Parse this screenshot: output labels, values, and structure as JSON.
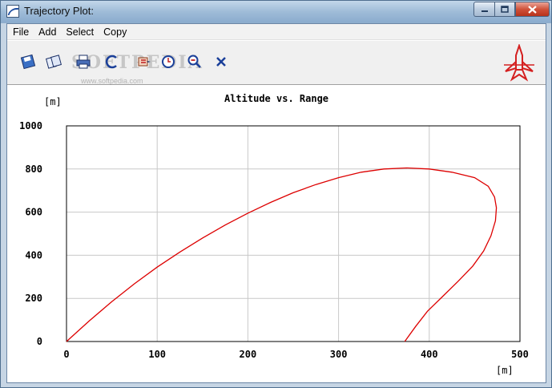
{
  "window": {
    "title": "Trajectory Plot:"
  },
  "menu": {
    "items": [
      "File",
      "Add",
      "Select",
      "Copy"
    ]
  },
  "toolbar": {
    "tools": [
      "diskette-icon",
      "copy-icon",
      "print-icon",
      "refresh-icon",
      "options-icon",
      "timer-icon",
      "zoom-out-icon",
      "close-x-icon"
    ],
    "watermark": "SOFTPEDIA",
    "watermark_url": "www.softpedia.com"
  },
  "colors": {
    "curve": "#dd0000",
    "grid": "#c8c8c8"
  },
  "chart_data": {
    "type": "line",
    "title": "Altitude vs. Range",
    "ylabel": "[m]",
    "xlabel": "[m]",
    "xlim": [
      0,
      500
    ],
    "ylim": [
      0,
      1000
    ],
    "xticks": [
      0,
      100,
      200,
      300,
      400,
      500
    ],
    "yticks": [
      0,
      200,
      400,
      600,
      800,
      1000
    ],
    "grid": true,
    "series": [
      {
        "x": [
          0,
          25,
          50,
          75,
          100,
          125,
          150,
          175,
          200,
          225,
          250,
          275,
          300,
          325,
          350,
          375,
          400,
          425,
          450,
          465,
          472,
          474,
          473,
          468,
          460,
          448,
          432,
          415,
          398,
          385,
          373
        ],
        "y": [
          0,
          95,
          185,
          268,
          345,
          415,
          480,
          540,
          595,
          645,
          690,
          728,
          760,
          785,
          800,
          805,
          800,
          785,
          760,
          720,
          670,
          620,
          560,
          490,
          420,
          350,
          280,
          210,
          140,
          70,
          0
        ]
      }
    ]
  }
}
